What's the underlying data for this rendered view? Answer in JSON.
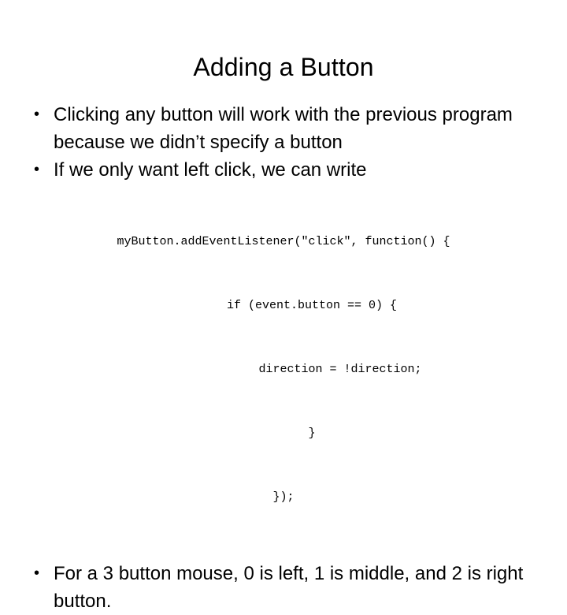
{
  "slide": {
    "title": "Adding a Button",
    "bullets_top": [
      {
        "marker": "•",
        "text": "Clicking any button will work with the previous program because we didn’t specify a button"
      },
      {
        "marker": "•",
        "text": "If we only want left click, we can write"
      }
    ],
    "code": {
      "lines": [
        "myButton.addEventListener(\"click\", function() {",
        "        if (event.button == 0) {",
        "                direction = !direction;",
        "        }",
        "});"
      ]
    },
    "bullets_bottom": [
      {
        "marker": "•",
        "text": "For a 3 button mouse, 0 is left, 1 is middle, and 2 is right button."
      }
    ]
  },
  "colors": {
    "background": "#ffffff",
    "text": "#000000"
  }
}
